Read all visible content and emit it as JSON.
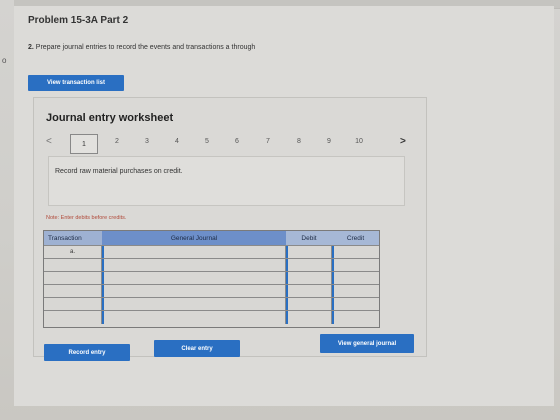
{
  "problem": {
    "title": "Problem 15-3A Part 2",
    "instruction_num": "2.",
    "instruction_text": "Prepare journal entries to record the events and transactions a through",
    "edge_mark": "o"
  },
  "buttons": {
    "view_transaction_list": "View transaction list",
    "record_entry": "Record entry",
    "clear_entry": "Clear entry",
    "view_general_journal": "View general journal"
  },
  "worksheet": {
    "title": "Journal entry worksheet",
    "pages": [
      "1",
      "2",
      "3",
      "4",
      "5",
      "6",
      "7",
      "8",
      "9",
      "10"
    ],
    "active_page": "1",
    "prev_glyph": "<",
    "next_glyph": ">",
    "description": "Record raw material purchases on credit.",
    "note": "Note: Enter debits before credits."
  },
  "journal": {
    "headers": {
      "transaction": "Transaction",
      "general_journal": "General Journal",
      "debit": "Debit",
      "credit": "Credit"
    },
    "rows": [
      {
        "transaction": "a.",
        "account": "",
        "debit": "",
        "credit": ""
      },
      {
        "transaction": "",
        "account": "",
        "debit": "",
        "credit": ""
      },
      {
        "transaction": "",
        "account": "",
        "debit": "",
        "credit": ""
      },
      {
        "transaction": "",
        "account": "",
        "debit": "",
        "credit": ""
      },
      {
        "transaction": "",
        "account": "",
        "debit": "",
        "credit": ""
      },
      {
        "transaction": "",
        "account": "",
        "debit": "",
        "credit": ""
      }
    ]
  },
  "colors": {
    "primary_button": "#2a6fc2",
    "header_blue": "#6d8fc9",
    "note_red": "#b04a3a"
  }
}
